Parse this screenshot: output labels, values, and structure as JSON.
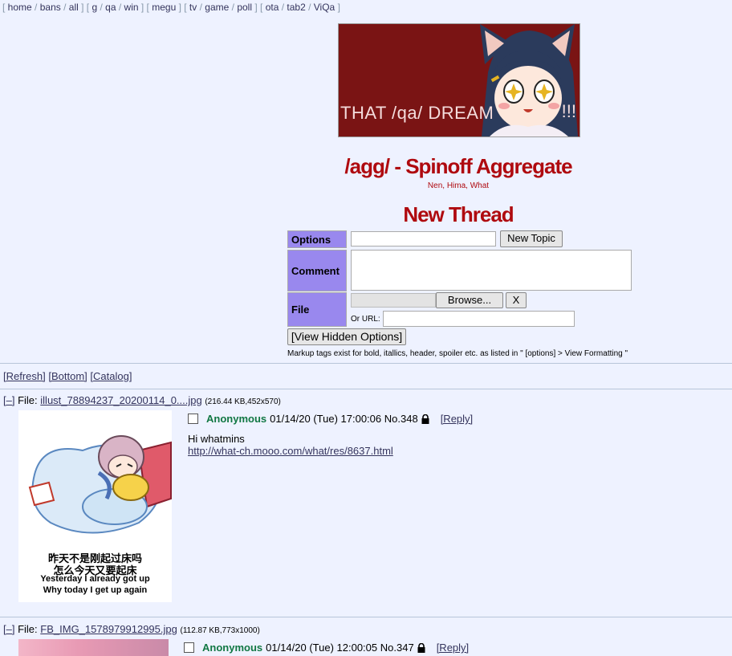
{
  "nav": {
    "groups": [
      [
        "home",
        "bans",
        "all"
      ],
      [
        "g",
        "qa",
        "win"
      ],
      [
        "megu"
      ],
      [
        "tv",
        "game",
        "poll"
      ],
      [
        "ota",
        "tab2",
        "ViQa"
      ]
    ]
  },
  "banner": {
    "text": "THAT /qa/ DREAM",
    "tail": "!!!"
  },
  "board": {
    "title": "/agg/ - Spinoff Aggregate",
    "subtitle": "Nen, Hima, What"
  },
  "form": {
    "heading": "New Thread",
    "options_label": "Options",
    "new_topic_label": "New Topic",
    "comment_label": "Comment",
    "file_label": "File",
    "browse_label": "Browse...",
    "clear_label": "X",
    "or_url_label": "Or URL:",
    "hidden_options_label": "[View Hidden Options]",
    "markup_note": "Markup tags exist for bold, itallics, header, spoiler etc. as listed in \" [options] > View Formatting \""
  },
  "controls": {
    "refresh": "[Refresh]",
    "bottom": "[Bottom]",
    "catalog": "[Catalog]"
  },
  "posts": [
    {
      "toggle": "[–]",
      "file_prefix": "File:",
      "file_name": "illust_78894237_20200114_0....jpg",
      "file_meta": "(216.44 KB,452x570)",
      "name": "Anonymous",
      "date": "01/14/20 (Tue) 17:00:06",
      "number": "No.348",
      "reply": "[Reply]",
      "body": "Hi whatmins",
      "link": "http://what-ch.mooo.com/what/res/8637.html",
      "thumb_caption": [
        "昨天不是刚起过床吗",
        "怎么今天又要起床",
        "Yesterday I already got up",
        "Why today I get up again"
      ]
    },
    {
      "toggle": "[–]",
      "file_prefix": "File:",
      "file_name": "FB_IMG_1578979912995.jpg",
      "file_meta": "(112.87 KB,773x1000)",
      "name": "Anonymous",
      "date": "01/14/20 (Tue) 12:00:05",
      "number": "No.347",
      "reply": "[Reply]"
    }
  ]
}
